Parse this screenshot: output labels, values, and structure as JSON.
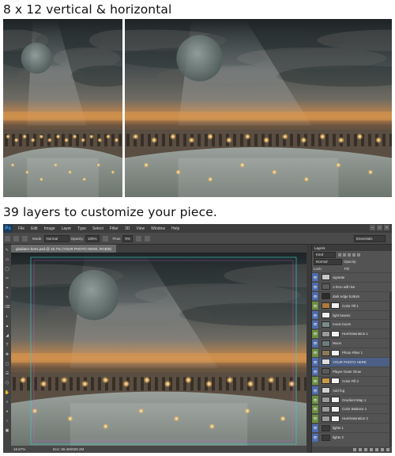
{
  "captions": {
    "top": "8 x 12 vertical & horizontal",
    "middle": "39 layers to customize your piece."
  },
  "photoshop": {
    "logo": "Ps",
    "menu": [
      "File",
      "Edit",
      "Image",
      "Layer",
      "Type",
      "Select",
      "Filter",
      "3D",
      "View",
      "Window",
      "Help"
    ],
    "options": {
      "mode_label": "Mode:",
      "mode_value": "Normal",
      "opacity_label": "Opacity:",
      "opacity_value": "100%",
      "flow_label": "Flow:",
      "flow_value": "9%",
      "workspace": "Essentials"
    },
    "document_tab": "gladiator-bees.psd @ 16.7% (YOUR PHOTO HERE, RGB/8)",
    "status": {
      "zoom": "16.67%",
      "doc": "Doc: 55.4M/928.2M"
    },
    "layers_panel": {
      "title": "Layers",
      "kind_label": "Kind",
      "blend_mode": "Normal",
      "opacity_label": "Opacity:",
      "lock_label": "Lock:",
      "fill_label": "Fill:",
      "layers": [
        {
          "name": "vignette",
          "eye": "on",
          "thumb": "#c8c8c8",
          "mask": false,
          "selected": false
        },
        {
          "name": "A hero will rise",
          "eye": "on",
          "thumb": "#5c5c5c",
          "mask": false,
          "selected": false
        },
        {
          "name": "dark edge bottom",
          "eye": "on",
          "thumb": "#2c2c2c",
          "mask": false,
          "selected": false
        },
        {
          "name": "Color Fill 1",
          "eye": "grn",
          "thumb": "#b07a3a",
          "mask": true,
          "selected": false
        },
        {
          "name": "light beams",
          "eye": "on",
          "thumb": "#efefef",
          "mask": false,
          "selected": false
        },
        {
          "name": "moon boom",
          "eye": "on",
          "thumb": "#7a8a8a",
          "mask": false,
          "selected": false
        },
        {
          "name": "Hue/Saturation 1",
          "eye": "grn",
          "thumb": "#9a9a9a",
          "mask": true,
          "selected": false
        },
        {
          "name": "Moon",
          "eye": "on",
          "thumb": "#6d7d7d",
          "mask": false,
          "selected": false
        },
        {
          "name": "Photo Filter 1",
          "eye": "grn",
          "thumb": "#8a7a5a",
          "mask": true,
          "selected": false
        },
        {
          "name": "YOUR PHOTO HERE",
          "eye": "on",
          "thumb": "#dcdcdc",
          "mask": false,
          "selected": true
        },
        {
          "name": "Player Outer Glow",
          "eye": "on",
          "thumb": "#5a5a5a",
          "mask": false,
          "selected": false
        },
        {
          "name": "Color Fill 2",
          "eye": "grn",
          "thumb": "#c69a4a",
          "mask": true,
          "selected": false
        },
        {
          "name": "Add fog",
          "eye": "on",
          "thumb": "#d0d0d0",
          "mask": false,
          "selected": false
        },
        {
          "name": "Gradient Map 1",
          "eye": "grn",
          "thumb": "#9a9a9a",
          "mask": true,
          "selected": false
        },
        {
          "name": "Color Balance 1",
          "eye": "grn",
          "thumb": "#9a9a9a",
          "mask": true,
          "selected": false
        },
        {
          "name": "Hue/Saturation 2",
          "eye": "grn",
          "thumb": "#9a9a9a",
          "mask": true,
          "selected": false
        },
        {
          "name": "lights 1",
          "eye": "on",
          "thumb": "#3a3a3a",
          "mask": false,
          "selected": false
        },
        {
          "name": "lights 2",
          "eye": "on",
          "thumb": "#3a3a3a",
          "mask": false,
          "selected": false
        }
      ]
    }
  }
}
